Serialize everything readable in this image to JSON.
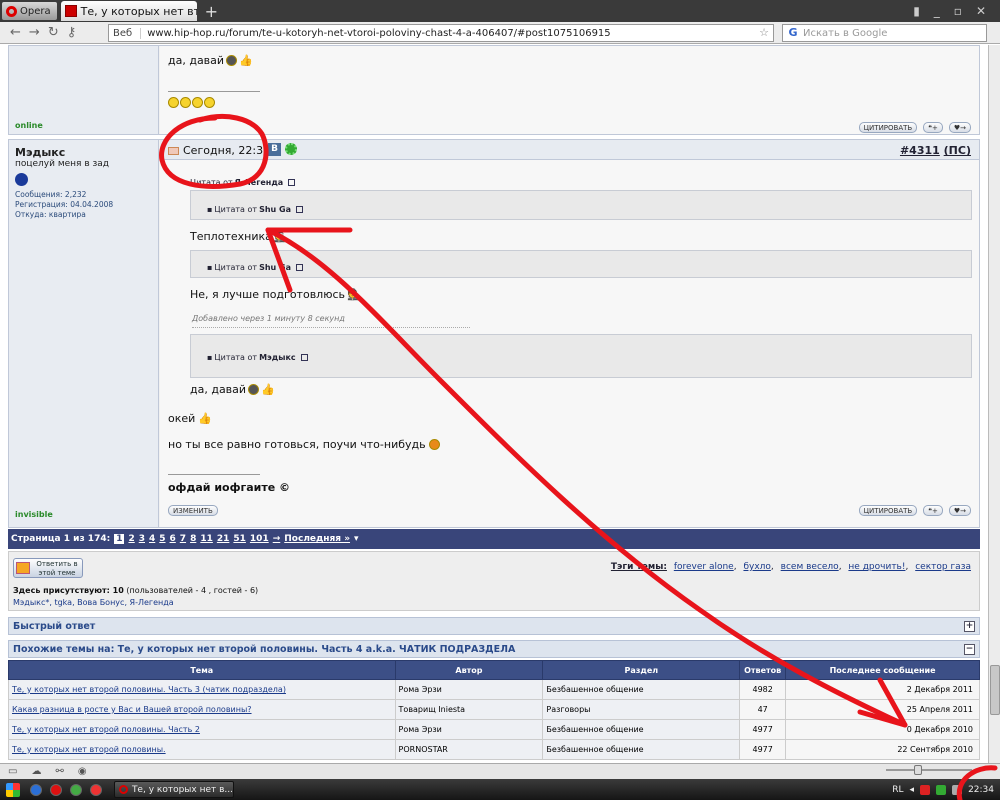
{
  "browser": {
    "menu_label": "Opera",
    "tab_title": "Те, у которых нет втор...",
    "tab_close": "×",
    "new_tab": "+",
    "url_prefix": "Веб",
    "url": "www.hip-hop.ru/forum/te-u-kotoryh-net-vtoroi-poloviny-chast-4-a-406407/#post1075106915",
    "search_placeholder": "Искать в Google"
  },
  "post_prev": {
    "status": "online",
    "line1": "да, давай",
    "quote_button": "ЦИТИРОВАТЬ"
  },
  "post_main": {
    "date": "Сегодня, 22:36",
    "vk_label": "В",
    "post_number": "#4311",
    "post_suffix": "(ПС)",
    "username": "Мэдыкс",
    "user_title": "поцелуй меня в зад",
    "stats": [
      "Сообщения: 2,232",
      "Регистрация: 04.04.2008",
      "Откуда: квартира"
    ],
    "status": "invisible",
    "quote_outer_author": "Я-Легенда",
    "quote_outer_prefix": "Цитата от",
    "q1_author": "Shu Ga",
    "q1_text": "Теплотехника",
    "q2_author": "Shu Ga",
    "q2_text": "Не, я лучше подготовлюсь",
    "added": "Добавлено через 1 минуту 8 секунд",
    "q3_author": "Мэдыкс",
    "q3_text": "да, давай",
    "body1": "окей",
    "body2": "но ты все равно готовься, поучи что-нибудь",
    "signature": "офдай иофгаите ©",
    "edit_button": "ИЗМЕНИТЬ",
    "quote_button": "ЦИТИРОВАТЬ"
  },
  "pagination": {
    "label": "Страница 1 из 174:",
    "current": "1",
    "pages": [
      "2",
      "3",
      "4",
      "5",
      "6",
      "7",
      "8",
      "11",
      "21",
      "51",
      "101"
    ],
    "next": "→",
    "last": "Последняя »",
    "menu": "▾"
  },
  "info": {
    "reply_button": "Ответить в этой теме",
    "tags_label": "Тэги темы:",
    "tags": [
      "forever alone",
      "бухло",
      "всем весело",
      "не дрочить!",
      "сектор газа"
    ],
    "present_label": "Здесь присутствуют: 10",
    "present_detail": "(пользователей - 4 , гостей - 6)",
    "present_users": "Мэдыкс*, tgka, Вова Бонус, Я-Легенда"
  },
  "quick_reply": {
    "title": "Быстрый ответ",
    "toggle": "+"
  },
  "similar": {
    "title": "Похожие темы на: Те, у которых нет второй половины. Часть 4 a.k.a. ЧАТИК ПОДРАЗДЕЛА",
    "toggle": "−",
    "headers": [
      "Тема",
      "Автор",
      "Раздел",
      "Ответов",
      "Последнее сообщение"
    ],
    "rows": [
      [
        "Те, у которых нет второй половины. Часть 3 (чатик подраздела)",
        "Рома Эрзи",
        "Безбашенное общение",
        "4982",
        "2 Декабря 2011"
      ],
      [
        "Какая разница в росте у Вас и Вашей второй половины?",
        "Товарищ Iniesta",
        "Разговоры",
        "47",
        "25 Апреля 2011"
      ],
      [
        "Те, у которых нет второй половины. Часть 2",
        "Рома Эрзи",
        "Безбашенное общение",
        "4977",
        "0 Декабря 2010"
      ],
      [
        "Те, у которых нет второй половины.",
        "PORNOSTAR",
        "Безбашенное общение",
        "4977",
        "22 Сентября 2010"
      ]
    ]
  },
  "taskbar": {
    "task_title": "Те, у которых нет в...",
    "lang": "RL",
    "clock": "22:34"
  },
  "colors": {
    "annotation": "#e8141b",
    "header_blue": "#3c4f86"
  }
}
